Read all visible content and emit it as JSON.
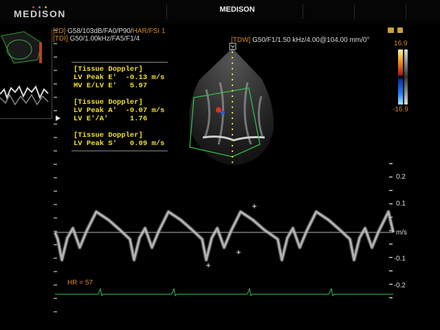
{
  "header": {
    "brand": "MEDISON",
    "device_name": "MEDISON",
    "brand_dot_colors": [
      "#e0412f",
      "#8b8b8b",
      "#e6a22a"
    ]
  },
  "params": {
    "line1_tag": "[2D]",
    "line1_values": "G58/103dB/FA0/P90/",
    "line1_mode": "HAR/FSI 1",
    "line2_tag": "[TDI]",
    "line2_values": "G50/1.00kHz/FA5/F1/4",
    "tdw_tag": "[TDW]",
    "tdw_values": "G50/F1/1.50 kHz/4.00@104.00 mm/0°"
  },
  "colorbar": {
    "max": "16.9",
    "min": "-16.9"
  },
  "measurements": [
    {
      "heading": "[Tissue Doppler]",
      "rows": [
        {
          "label": "LV Peak E'  ",
          "value": "-0.13",
          "unit": "m/s"
        },
        {
          "label": "MV E/LV E'  ",
          "value": " 5.97",
          "unit": ""
        }
      ]
    },
    {
      "heading": "[Tissue Doppler]",
      "rows": [
        {
          "label": "LV Peak A'  ",
          "value": "-0.07",
          "unit": "m/s"
        },
        {
          "label": "LV E'/A'    ",
          "value": " 1.76",
          "unit": ""
        }
      ]
    },
    {
      "heading": "[Tissue Doppler]",
      "rows": [
        {
          "label": "LV Peak S'  ",
          "value": " 0.09",
          "unit": "m/s"
        }
      ]
    }
  ],
  "doppler_scale": {
    "unit": "m/s",
    "ticks": [
      "0.2",
      "0.1",
      "-0.1",
      "-0.2"
    ]
  },
  "heart_rate": "HR = 57"
}
